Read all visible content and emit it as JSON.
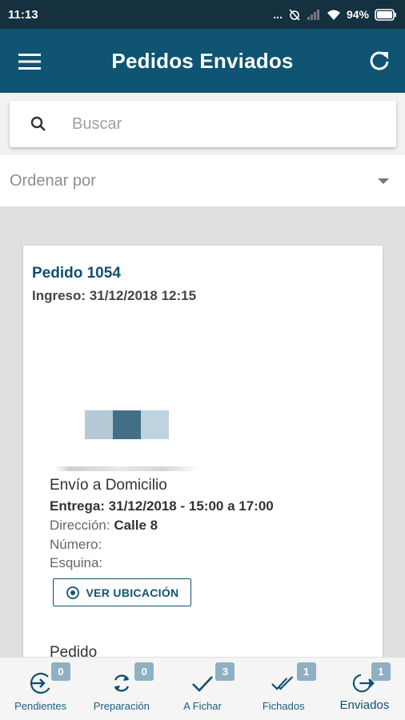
{
  "status_bar": {
    "time": "11:13",
    "dots": "...",
    "battery": "94%"
  },
  "app_bar": {
    "title": "Pedidos Enviados",
    "menu_icon": "hamburger-menu-icon",
    "refresh_icon": "refresh-icon"
  },
  "search": {
    "placeholder": "Buscar",
    "value": ""
  },
  "sort": {
    "label": "Ordenar por"
  },
  "order": {
    "title": "Pedido 1054",
    "ingreso": "Ingreso: 31/12/2018 12:15",
    "shipping_type": "Envío a Domicilio",
    "delivery": "Entrega: 31/12/2018 - 15:00 a 17:00",
    "address_label": "Dirección:",
    "address_value": "Calle 8",
    "number_label": "Número:",
    "corner_label": "Esquina:",
    "location_button": "VER UBICACIÓN",
    "items_label": "Pedido"
  },
  "bottom_nav": [
    {
      "label": "Pendientes",
      "badge": "0",
      "icon": "login-arrow-icon"
    },
    {
      "label": "Preparación",
      "badge": "0",
      "icon": "sync-icon"
    },
    {
      "label": "A Fichar",
      "badge": "3",
      "icon": "check-icon"
    },
    {
      "label": "Fichados",
      "badge": "1",
      "icon": "double-check-icon"
    },
    {
      "label": "Enviados",
      "badge": "1",
      "icon": "logout-arrow-icon"
    }
  ],
  "colors": {
    "primary": "#0f5472",
    "status_bar": "#15303f",
    "badge": "#8fb0c3"
  }
}
